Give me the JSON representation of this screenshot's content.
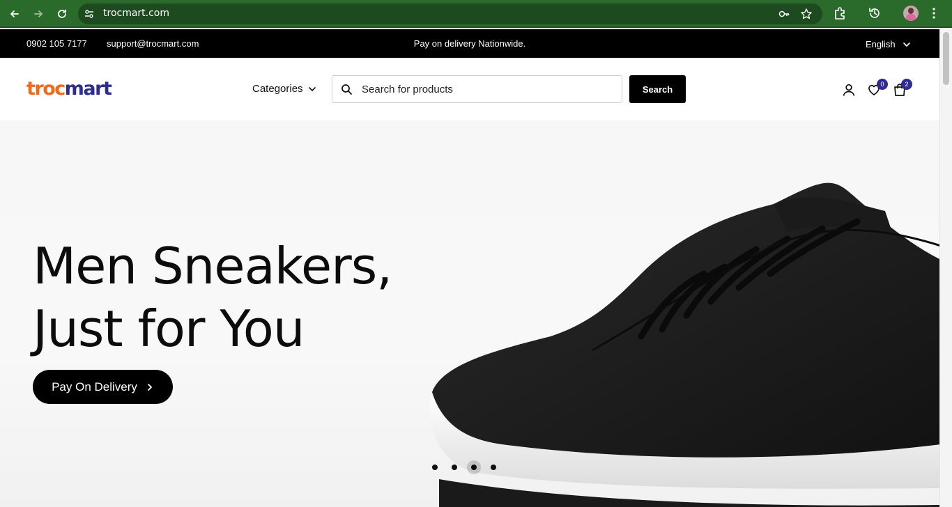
{
  "browser": {
    "url": "trocmart.com",
    "accent_color": "#2a6a2b",
    "icons": [
      "back-icon",
      "forward-icon",
      "reload-icon",
      "site-settings-icon",
      "password-key-icon",
      "bookmark-star-icon",
      "extensions-icon",
      "history-icon",
      "profile-avatar",
      "more-menu-icon"
    ]
  },
  "topbar": {
    "phone": "0902 105 7177",
    "email": "support@trocmart.com",
    "promo": "Pay on delivery Nationwide.",
    "language": "English"
  },
  "header": {
    "logo_part1": "troc",
    "logo_part2": "mart",
    "logo_colors": {
      "orange": "#f26a1b",
      "blue": "#2e2c8f"
    },
    "categories_label": "Categories",
    "search_placeholder": "Search for products",
    "search_button": "Search",
    "wishlist_count": "0",
    "cart_count": "2",
    "badge_color": "#2f2b93"
  },
  "hero": {
    "title_line1": "Men Sneakers,",
    "title_line2": "Just for You",
    "cta_label": "Pay On Delivery",
    "slide_count": 4,
    "active_slide": 3
  }
}
